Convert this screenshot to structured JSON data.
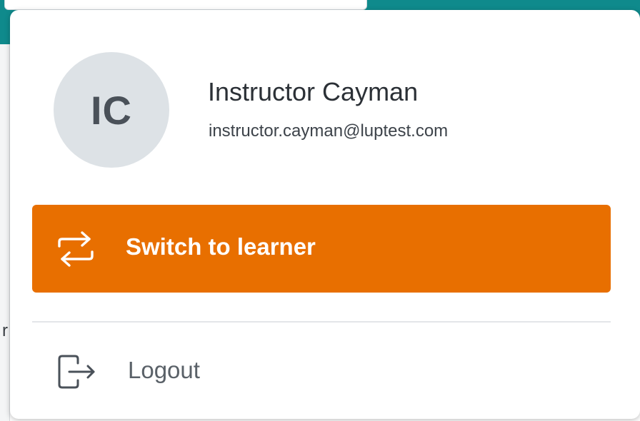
{
  "menu": {
    "avatar_initials": "IC",
    "user_name": "Instructor Cayman",
    "user_email": "instructor.cayman@luptest.com",
    "switch_button_label": "Switch to learner",
    "switch_icon": "switch-arrows-icon",
    "logout_label": "Logout",
    "logout_icon": "logout-icon"
  },
  "background": {
    "stray_text": "r"
  },
  "colors": {
    "header": "#0f8a8c",
    "accent": "#e86f00",
    "avatar_bg": "#dde2e6"
  }
}
